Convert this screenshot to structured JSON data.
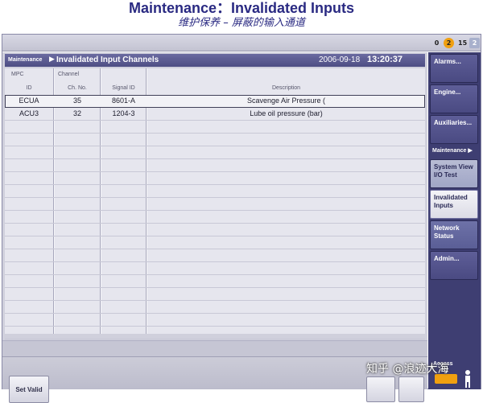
{
  "slide": {
    "title": "Maintenance：Invalidated Inputs",
    "subtitle": "维护保养 – 屏蔽的输入通道"
  },
  "status": {
    "counts": [
      "0",
      "2",
      "15",
      "2"
    ],
    "accent": "#f0a010"
  },
  "panel": {
    "breadcrumb_root": "Maintenance",
    "title": "Invalidated Input Channels",
    "date": "2006-09-18",
    "time": "13:20:37"
  },
  "table": {
    "group_headers": [
      "MPC",
      "Channel"
    ],
    "columns": [
      "ID",
      "Ch. No.",
      "Signal ID",
      "Description"
    ],
    "rows": [
      {
        "id": "ECUA",
        "ch_no": "35",
        "signal_id": "8601-A",
        "description": "Scavenge Air Pressure (",
        "selected": true
      },
      {
        "id": "ACU3",
        "ch_no": "32",
        "signal_id": "1204-3",
        "description": "Lube oil pressure (bar)",
        "selected": false
      }
    ],
    "empty_rows": 17
  },
  "footer": {
    "set_valid_label": "Set Valid"
  },
  "nav": {
    "alarms": "Alarms...",
    "engine": "Engine...",
    "auxiliaries": "Auxiliaries...",
    "section": "Maintenance",
    "system_view": "System View I/O Test",
    "invalidated": "Invalidated Inputs",
    "network": "Network Status",
    "admin": "Admin...",
    "access": "Access"
  },
  "watermark": "知乎 @浪迹大海"
}
